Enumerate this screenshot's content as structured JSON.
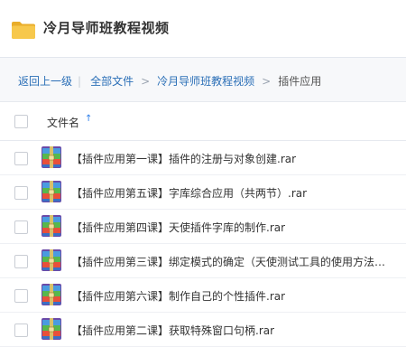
{
  "header": {
    "title": "冷月导师班教程视频",
    "icon": "folder-icon"
  },
  "breadcrumb": {
    "back": "返回上一级",
    "items": [
      "全部文件",
      "冷月导师班教程视频"
    ],
    "current": "插件应用"
  },
  "table": {
    "column_name": "文件名",
    "sort_icon": "↑",
    "rows": [
      {
        "name": "【插件应用第一课】插件的注册与对象创建.rar"
      },
      {
        "name": "【插件应用第五课】字库综合应用（共两节）.rar"
      },
      {
        "name": "【插件应用第四课】天使插件字库的制作.rar"
      },
      {
        "name": "【插件应用第三课】绑定模式的确定（天使测试工具的使用方法…"
      },
      {
        "name": "【插件应用第六课】制作自己的个性插件.rar"
      },
      {
        "name": "【插件应用第二课】获取特殊窗口句柄.rar"
      }
    ]
  },
  "colors": {
    "link": "#2b6fb7",
    "folder": "#f5c247",
    "accent": "#2b7de9"
  }
}
